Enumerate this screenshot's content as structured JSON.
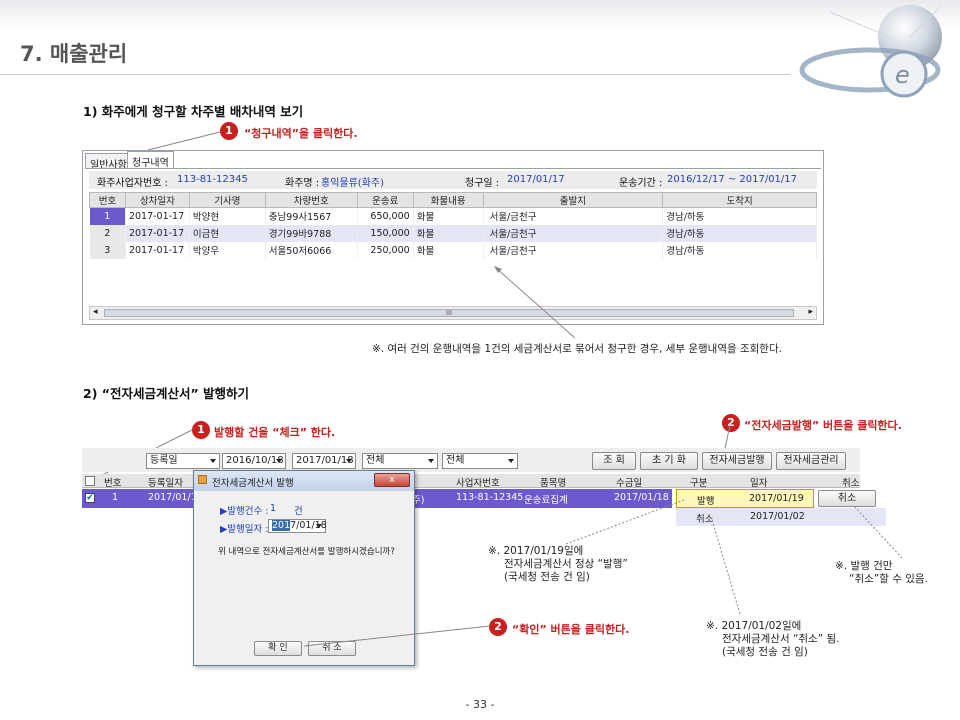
{
  "page": {
    "title": "7. 매출관리",
    "page_number": "- 33 -"
  },
  "section1": {
    "heading": "1) 화주에게 청구할 차주별 배차내역 보기",
    "callout_num": "1",
    "callout_text": "“청구내역”을 클릭한다.",
    "tabs": [
      "일반사항",
      "청구내역"
    ],
    "info": {
      "bizno_label": "화주사업자번호 :",
      "bizno": "113-81-12345",
      "shipper_label": "화주명 :",
      "shipper": "홍익물류(화주)",
      "billdate_label": "청구일 :",
      "billdate": "2017/01/17",
      "period_label": "운송기간 :",
      "period": "2016/12/17 ~ 2017/01/17"
    },
    "columns": [
      "번호",
      "상차일자",
      "기사명",
      "차량번호",
      "운송료",
      "화물내용",
      "출발지",
      "도착지"
    ],
    "rows": [
      [
        "1",
        "2017-01-17",
        "박양현",
        "충남99사1567",
        "650,000",
        "화물",
        "서울/금천구",
        "경남/하동"
      ],
      [
        "2",
        "2017-01-17",
        "이금현",
        "경기99바9788",
        "150,000",
        "화물",
        "서울/금천구",
        "경남/하동"
      ],
      [
        "3",
        "2017-01-17",
        "박양우",
        "서울50저6066",
        "250,000",
        "화물",
        "서울/금천구",
        "경남/하동"
      ]
    ],
    "scroll_thumb": "III",
    "note": "※. 여러 건의 운행내역을 1건의 세금계산서로 묶어서 청구한 경우, 세부 운행내역을 조회한다."
  },
  "section2": {
    "heading": "2) “전자세금계산서” 발행하기",
    "callout1_num": "1",
    "callout1_text": "발행할 건을 “체크” 한다.",
    "callout2_num": "2",
    "callout2_text": "“전자세금발행” 버튼을 클릭한다.",
    "callout3_num": "2",
    "callout3_text": "“확인” 버튼을 클릭한다.",
    "toolbar": {
      "date_type": "등록일",
      "date_from": "2016/10/18",
      "date_to": "2017/01/18",
      "filter1": "전체",
      "filter2": "전체",
      "btn_search": "조 회",
      "btn_reset": "초 기 화",
      "btn_issue": "전자세금발행",
      "btn_manage": "전자세금관리"
    },
    "grid_columns": [
      "번호",
      "등록일자",
      "사업자번호",
      "품목명",
      "수금일"
    ],
    "grid_row": {
      "num": "1",
      "regdate": "2017/01/17",
      "partial": "주)",
      "bizno": "113-81-12345",
      "item": "운송료집계",
      "coldate": "2017/01/18"
    },
    "sub_columns": [
      "구분",
      "일자",
      "취소"
    ],
    "sub_rows": [
      {
        "type": "발행",
        "date": "2017/01/19",
        "cancel_btn": "취소"
      },
      {
        "type": "취소",
        "date": "2017/01/02",
        "cancel_btn": ""
      }
    ],
    "dialog": {
      "title": "전자세금계산서 발행",
      "count_label": "▶발행건수 :",
      "count": "1",
      "count_unit": "건",
      "date_label": "▶발행일자 :",
      "date_sel": "201",
      "date_rest": "7/01/18",
      "message": "위 내역으로 전자세금계산서를 발행하시겠습니까?",
      "ok": "확 인",
      "cancel": "취 소",
      "close": "x"
    },
    "note1": [
      "※. 2017/01/19일에",
      "전자세금계산서 정상 “발행”",
      "(국세청 전송 건 임)"
    ],
    "note2": [
      "※. 발행 건만",
      "“취소”할 수 있음."
    ],
    "note3": [
      "※. 2017/01/02일에",
      "전자세금계산서 “취소” 됨.",
      "(국세청 전송 건 임)"
    ]
  }
}
